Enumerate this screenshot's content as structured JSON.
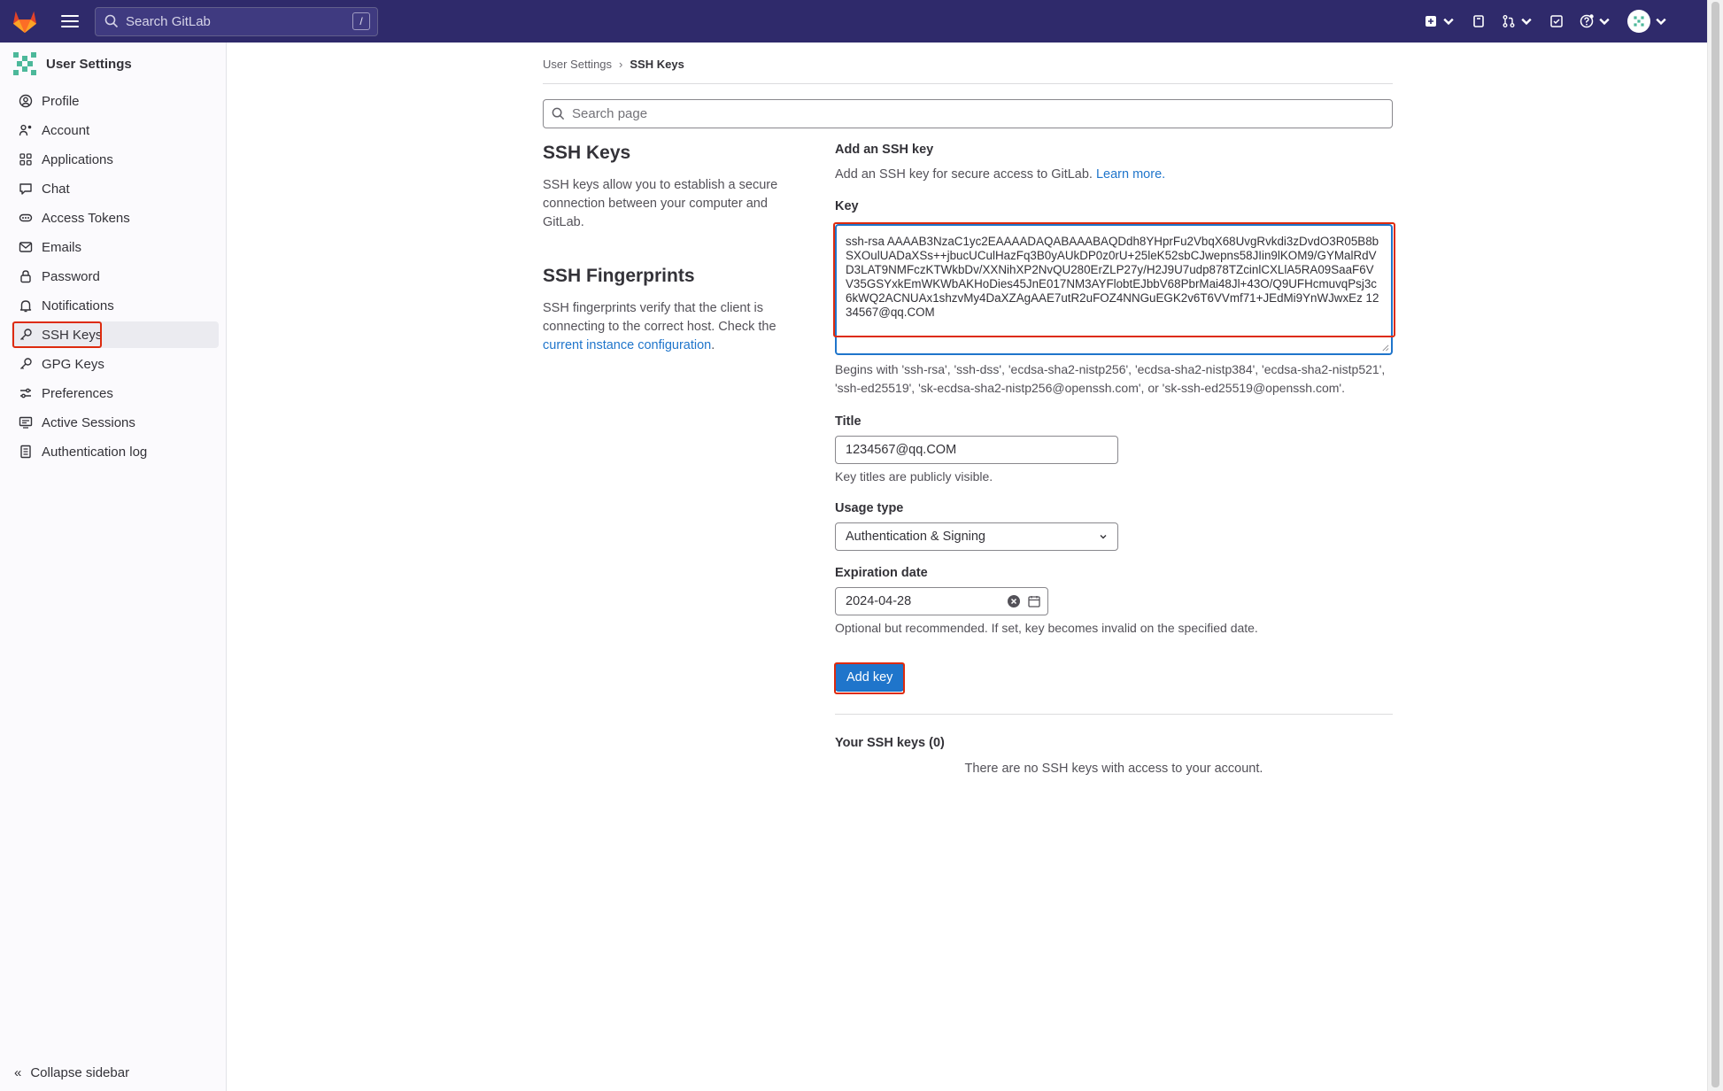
{
  "topbar": {
    "search_placeholder": "Search GitLab",
    "search_shortcut": "/"
  },
  "sidebar": {
    "title": "User Settings",
    "items": [
      {
        "label": "Profile",
        "icon": "profile-icon"
      },
      {
        "label": "Account",
        "icon": "account-icon"
      },
      {
        "label": "Applications",
        "icon": "applications-icon"
      },
      {
        "label": "Chat",
        "icon": "chat-icon"
      },
      {
        "label": "Access Tokens",
        "icon": "token-icon"
      },
      {
        "label": "Emails",
        "icon": "mail-icon"
      },
      {
        "label": "Password",
        "icon": "lock-icon"
      },
      {
        "label": "Notifications",
        "icon": "bell-icon"
      },
      {
        "label": "SSH Keys",
        "icon": "key-icon",
        "active": true
      },
      {
        "label": "GPG Keys",
        "icon": "key-icon"
      },
      {
        "label": "Preferences",
        "icon": "preferences-icon"
      },
      {
        "label": "Active Sessions",
        "icon": "monitor-icon"
      },
      {
        "label": "Authentication log",
        "icon": "log-icon"
      }
    ],
    "collapse_label": "Collapse sidebar"
  },
  "breadcrumb": {
    "parent": "User Settings",
    "current": "SSH Keys"
  },
  "page_search_placeholder": "Search page",
  "info": {
    "ssh_title": "SSH Keys",
    "ssh_desc": "SSH keys allow you to establish a secure connection between your computer and GitLab.",
    "fp_title": "SSH Fingerprints",
    "fp_desc": "SSH fingerprints verify that the client is connecting to the correct host. Check the",
    "fp_link": "current instance configuration",
    "fp_end": "."
  },
  "form": {
    "heading": "Add an SSH key",
    "intro": "Add an SSH key for secure access to GitLab.",
    "learn_more": "Learn more.",
    "key_label": "Key",
    "key_value": "ssh-rsa AAAAB3NzaC1yc2EAAAADAQABAAABAQDdh8YHprFu2VbqX68UvgRvkdi3zDvdO3R05B8bSXOulUADaXSs++jbucUCulHazFq3B0yAUkDP0z0rU+25leK52sbCJwepns58JIin9lKOM9/GYMalRdVD3LAT9NMFczKTWkbDv/XXNihXP2NvQU280ErZLP27y/H2J9U7udp878TZcinlCXLlA5RA09SaaF6VV35GSYxkEmWKWbAKHoDies45JnE017NM3AYFlobtEJbbV68PbrMai48Jl+43O/Q9UFHcmuvqPsj3c6kWQ2ACNUAx1shzvMy4DaXZAgAAE7utR2uFOZ4NNGuEGK2v6T6VVmf71+JEdMi9YnWJwxEz 1234567@qq.COM",
    "key_hint": "Begins with 'ssh-rsa', 'ssh-dss', 'ecdsa-sha2-nistp256', 'ecdsa-sha2-nistp384', 'ecdsa-sha2-nistp521', 'ssh-ed25519', 'sk-ecdsa-sha2-nistp256@openssh.com', or 'sk-ssh-ed25519@openssh.com'.",
    "title_label": "Title",
    "title_value": "1234567@qq.COM",
    "title_hint": "Key titles are publicly visible.",
    "usage_label": "Usage type",
    "usage_value": "Authentication & Signing",
    "expiration_label": "Expiration date",
    "expiration_value": "2024-04-28",
    "expiration_hint": "Optional but recommended. If set, key becomes invalid on the specified date.",
    "submit_label": "Add key"
  },
  "keys_list": {
    "heading": "Your SSH keys (0)",
    "empty_text": "There are no SSH keys with access to your account."
  },
  "colors": {
    "topbar": "#2f2a6b",
    "accent": "#1f75cb",
    "highlight_box": "#dd2b0e"
  }
}
